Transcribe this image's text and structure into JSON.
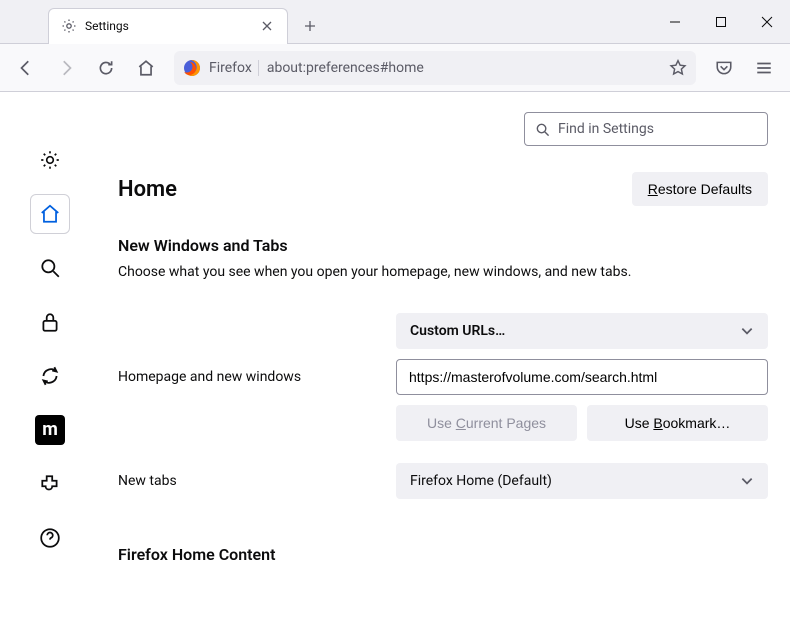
{
  "tab": {
    "title": "Settings"
  },
  "urlbar": {
    "identity": "Firefox",
    "url": "about:preferences#home"
  },
  "search": {
    "placeholder": "Find in Settings"
  },
  "page": {
    "heading": "Home",
    "restore": "estore Defaults",
    "restore_prefix": "R",
    "section1_title": "New Windows and Tabs",
    "section1_desc": "Choose what you see when you open your homepage, new windows, and new tabs.",
    "homepage_label": "Homepage and new windows",
    "homepage_select": "Custom URLs…",
    "homepage_url": "https://masterofvolume.com/search.html",
    "use_current_prefix": "Use ",
    "use_current_ul": "C",
    "use_current_suffix": "urrent Pages",
    "use_bookmark_prefix": "Use ",
    "use_bookmark_ul": "B",
    "use_bookmark_suffix": "ookmark…",
    "newtabs_label": "New tabs",
    "newtabs_select": "Firefox Home (Default)",
    "section2_title": "Firefox Home Content"
  }
}
